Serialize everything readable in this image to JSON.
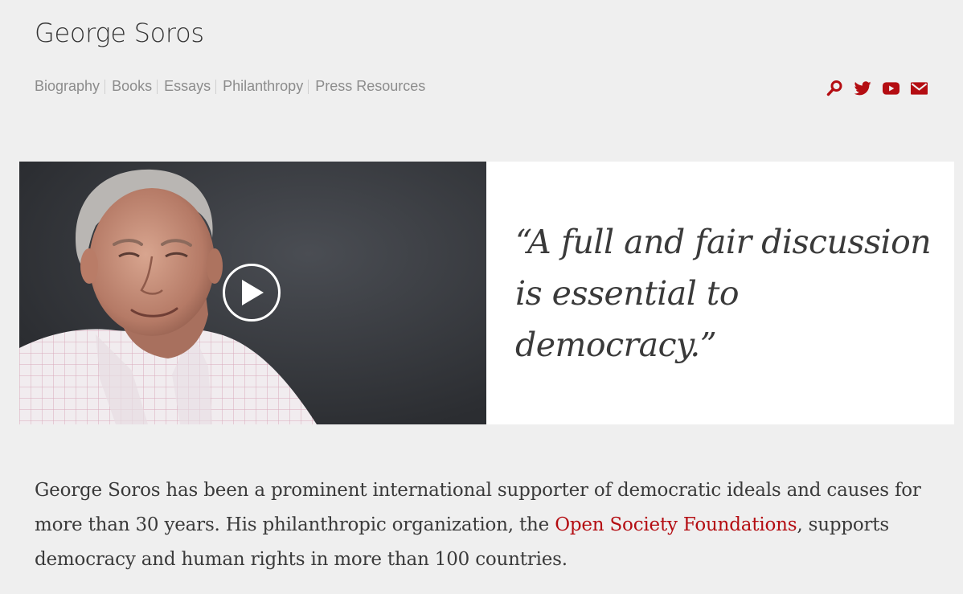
{
  "site": {
    "title": "George Soros"
  },
  "nav": {
    "items": [
      {
        "label": "Biography"
      },
      {
        "label": "Books"
      },
      {
        "label": "Essays"
      },
      {
        "label": "Philanthropy"
      },
      {
        "label": "Press Resources"
      }
    ]
  },
  "social": {
    "icons": [
      "search-icon",
      "twitter-icon",
      "youtube-icon",
      "email-icon"
    ],
    "color": "#b40d12"
  },
  "hero": {
    "quote_line1": "“A full and fair discussion",
    "quote_line2": "is essential to democracy.”"
  },
  "intro": {
    "text_before": "George Soros has been a prominent international supporter of democratic ideals and causes for more than 30 years. His philanthropic organization, the ",
    "link_label": "Open Society Foundations",
    "text_after": ", supports democracy and human rights in more than 100 countries."
  },
  "colors": {
    "background": "#efefef",
    "accent": "#b40d12",
    "nav_text": "#8c8c8c"
  }
}
